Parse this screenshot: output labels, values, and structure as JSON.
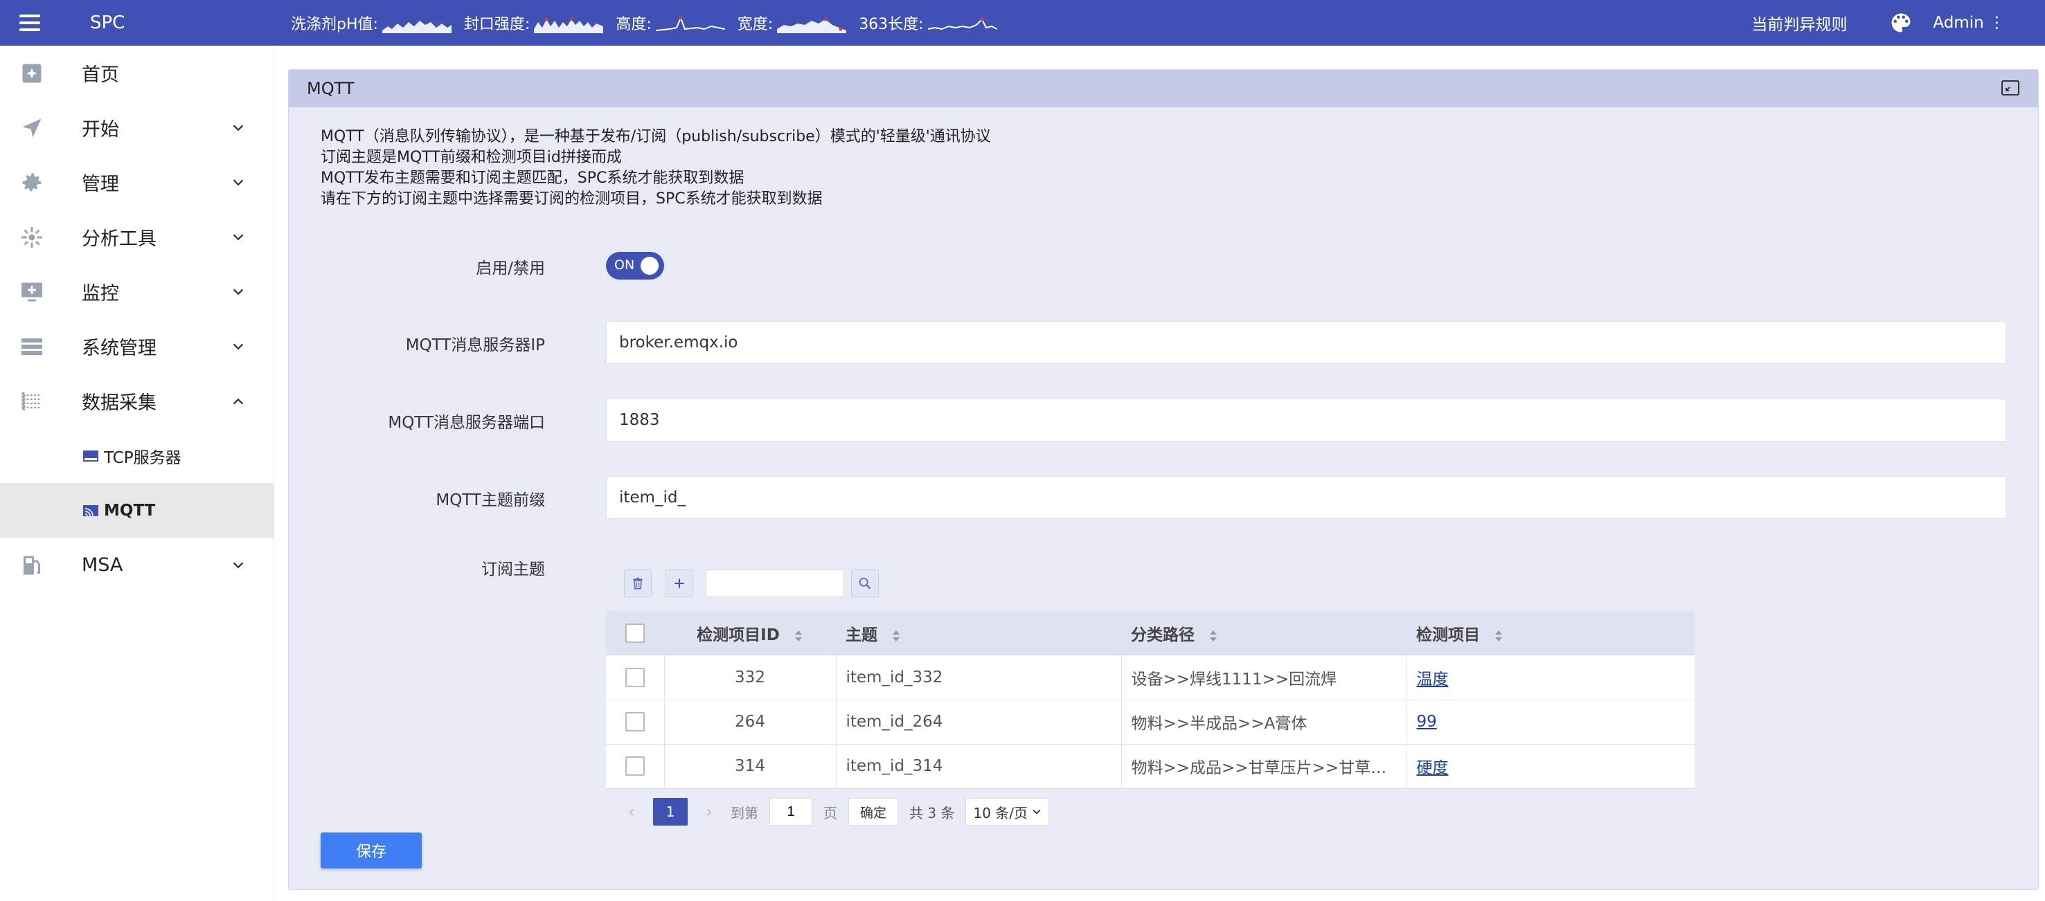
{
  "topbar": {
    "brand": "SPC",
    "metrics": [
      {
        "label": "洗涤剂pH值:"
      },
      {
        "label": "封口强度:"
      },
      {
        "label": "高度:"
      },
      {
        "label": "宽度:"
      },
      {
        "label": "363长度:"
      }
    ],
    "rule_link": "当前判异规则",
    "admin": "Admin ⋮",
    "colors": {
      "primary": "#3f51b5"
    }
  },
  "sidebar": {
    "items": [
      {
        "label": "首页",
        "icon": "dashboard-icon"
      },
      {
        "label": "开始",
        "icon": "send-icon"
      },
      {
        "label": "管理",
        "icon": "gear-icon"
      },
      {
        "label": "分析工具",
        "icon": "analysis-icon"
      },
      {
        "label": "监控",
        "icon": "monitor-icon"
      },
      {
        "label": "系统管理",
        "icon": "list-icon"
      },
      {
        "label": "数据采集",
        "icon": "data-collect-icon"
      },
      {
        "label": "MSA",
        "icon": "msa-icon"
      }
    ],
    "sub_items": [
      {
        "label": "TCP服务器",
        "icon": "tcp-icon"
      },
      {
        "label": "MQTT",
        "icon": "mqtt-icon",
        "active": true
      }
    ]
  },
  "panel": {
    "title": "MQTT",
    "description": [
      "MQTT（消息队列传输协议），是一种基于发布/订阅（publish/subscribe）模式的'轻量级'通讯协议",
      "订阅主题是MQTT前缀和检测项目id拼接而成",
      "MQTT发布主题需要和订阅主题匹配，SPC系统才能获取到数据",
      "请在下方的订阅主题中选择需要订阅的检测项目，SPC系统才能获取到数据"
    ],
    "form": {
      "enable_label": "启用/禁用",
      "enable_value": "ON",
      "server_ip_label": "MQTT消息服务器IP",
      "server_ip_value": "broker.emqx.io",
      "server_port_label": "MQTT消息服务器端口",
      "server_port_value": "1883",
      "topic_prefix_label": "MQTT主题前缀",
      "topic_prefix_value": "item_id_",
      "subscribe_label": "订阅主题"
    },
    "table": {
      "columns": [
        "检测项目ID",
        "主题",
        "分类路径",
        "检测项目"
      ],
      "rows": [
        {
          "id": "332",
          "topic": "item_id_332",
          "path": "设备>>焊线1111>>回流焊",
          "item": "温度"
        },
        {
          "id": "264",
          "topic": "item_id_264",
          "path": "物料>>半成品>>A膏体",
          "item": "99"
        },
        {
          "id": "314",
          "topic": "item_id_314",
          "path": "物料>>成品>>甘草压片>>甘草压...",
          "item": "硬度"
        }
      ]
    },
    "pagination": {
      "current_page": "1",
      "goto_label": "到第",
      "goto_value": "1",
      "page_unit": "页",
      "confirm": "确定",
      "total": "共 3 条",
      "page_size": "10 条/页"
    },
    "save_label": "保存"
  }
}
